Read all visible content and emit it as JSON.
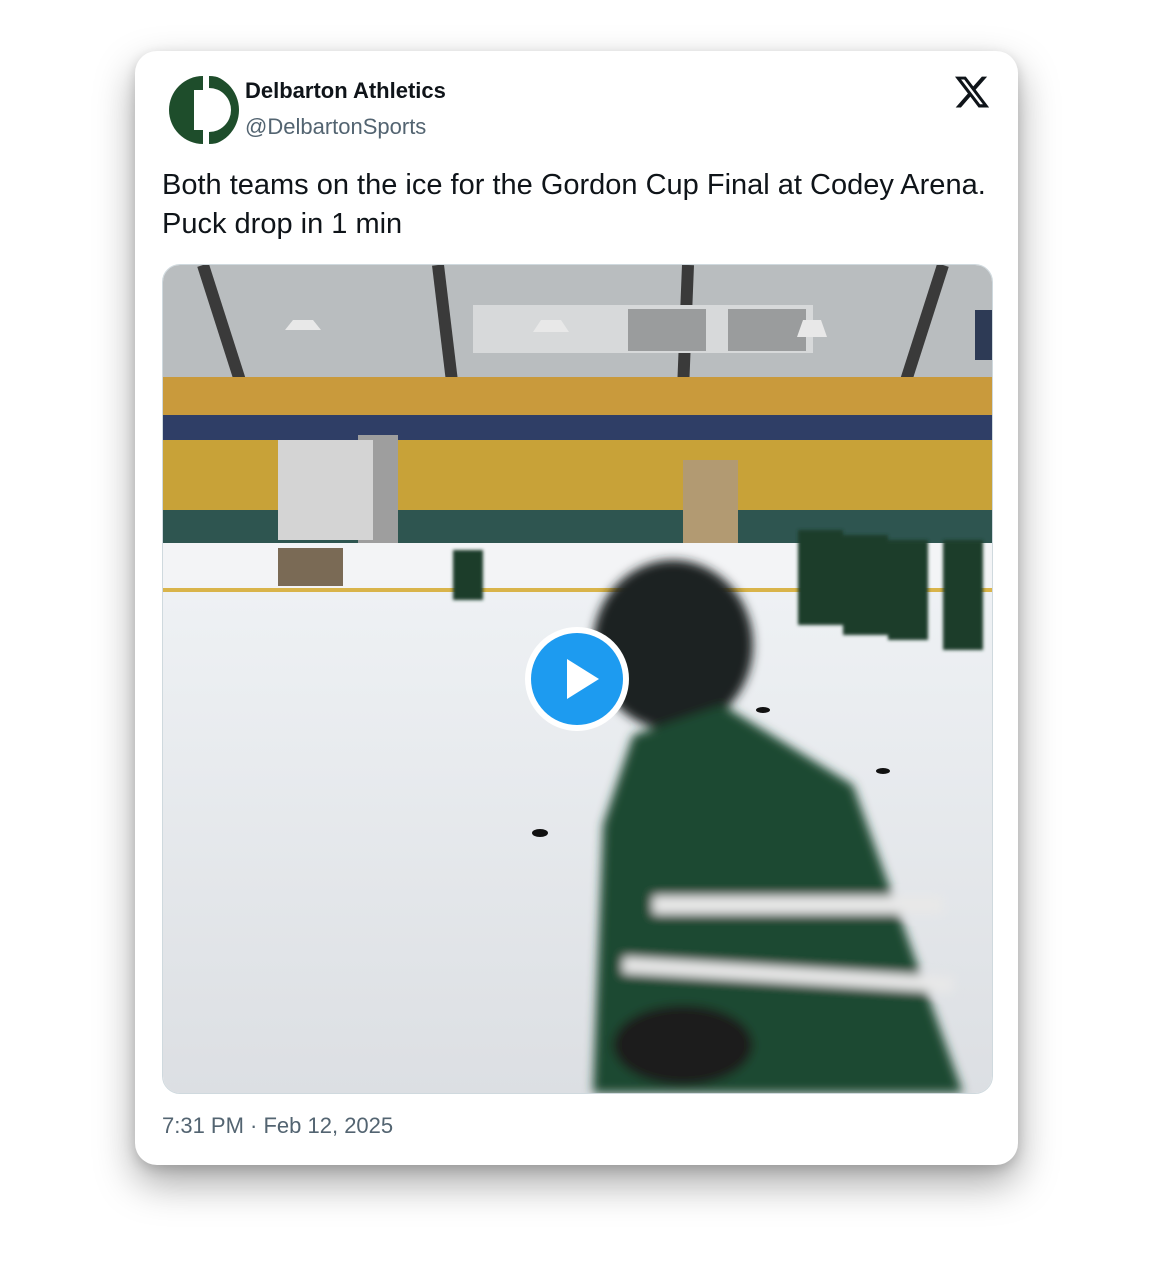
{
  "author": {
    "display_name": "Delbarton Athletics",
    "handle": "@DelbartonSports",
    "avatar_icon": "delbarton-logo",
    "brand_color": "#1e4d2b"
  },
  "platform_icon": "x-logo-icon",
  "tweet": {
    "text": "Both teams on the ice for the Gordon Cup Final at Codey Arena. Puck drop in 1 min"
  },
  "media": {
    "type": "video",
    "play_icon": "play-icon",
    "play_color": "#1d9bf0"
  },
  "timestamp": "7:31 PM · Feb 12, 2025"
}
